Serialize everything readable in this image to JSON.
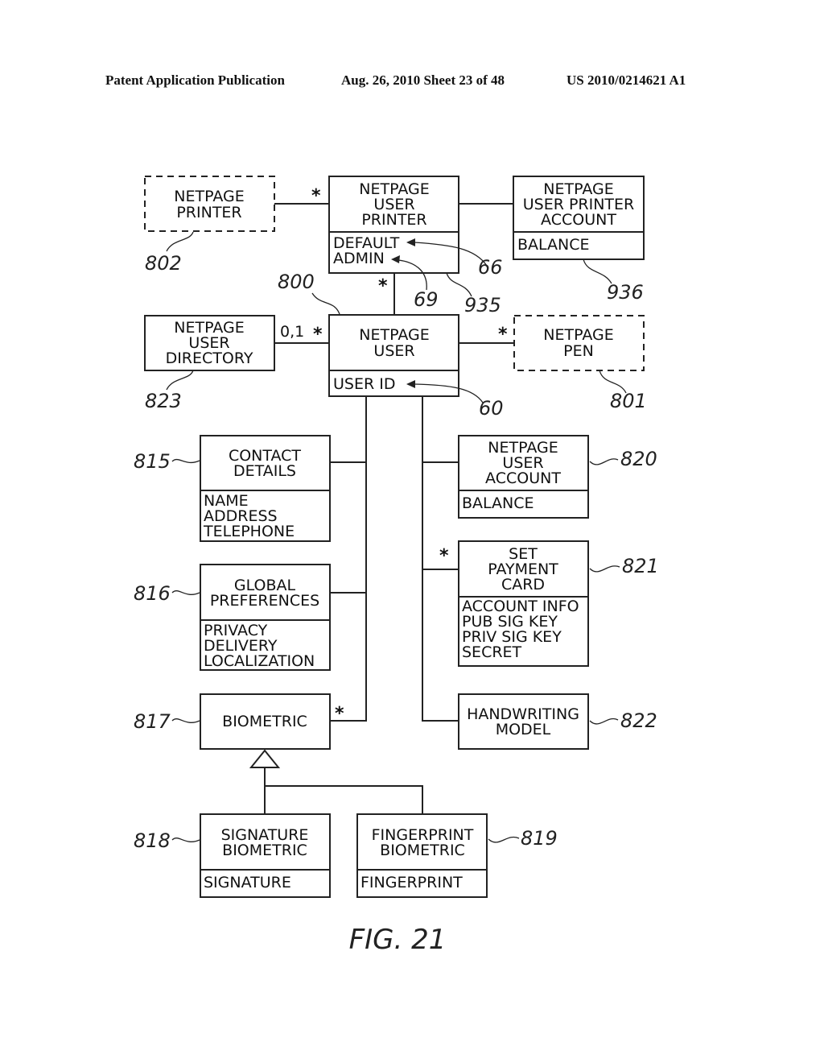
{
  "header": {
    "left": "Patent Application Publication",
    "middle": "Aug. 26, 2010  Sheet 23 of 48",
    "right": "US 2010/0214621 A1"
  },
  "figure": {
    "caption": "FIG. 21",
    "classes": {
      "netpage_printer": {
        "name": [
          "NETPAGE",
          "PRINTER"
        ],
        "ref": "802",
        "style": "dashed"
      },
      "netpage_user_printer": {
        "name": [
          "NETPAGE",
          "USER",
          "PRINTER"
        ],
        "attributes": [
          "DEFAULT",
          "ADMIN"
        ],
        "ref": "935"
      },
      "netpage_user_printer_account": {
        "name": [
          "NETPAGE",
          "USER PRINTER",
          "ACCOUNT"
        ],
        "attributes": [
          "BALANCE"
        ],
        "ref": "936"
      },
      "netpage_user_directory": {
        "name": [
          "NETPAGE",
          "USER",
          "DIRECTORY"
        ],
        "ref": "823"
      },
      "netpage_user": {
        "name": [
          "NETPAGE",
          "USER"
        ],
        "attributes": [
          "USER ID"
        ],
        "ref": "800"
      },
      "netpage_pen": {
        "name": [
          "NETPAGE",
          "PEN"
        ],
        "ref": "801",
        "style": "dashed"
      },
      "contact_details": {
        "name": [
          "CONTACT",
          "DETAILS"
        ],
        "attributes": [
          "NAME",
          "ADDRESS",
          "TELEPHONE"
        ],
        "ref": "815"
      },
      "global_preferences": {
        "name": [
          "GLOBAL",
          "PREFERENCES"
        ],
        "attributes": [
          "PRIVACY",
          "DELIVERY",
          "LOCALIZATION"
        ],
        "ref": "816"
      },
      "biometric": {
        "name": [
          "BIOMETRIC"
        ],
        "ref": "817"
      },
      "signature_biometric": {
        "name": [
          "SIGNATURE",
          "BIOMETRIC"
        ],
        "attributes": [
          "SIGNATURE"
        ],
        "ref": "818"
      },
      "fingerprint_biometric": {
        "name": [
          "FINGERPRINT",
          "BIOMETRIC"
        ],
        "attributes": [
          "FINGERPRINT"
        ],
        "ref": "819"
      },
      "netpage_user_account": {
        "name": [
          "NETPAGE",
          "USER",
          "ACCOUNT"
        ],
        "attributes": [
          "BALANCE"
        ],
        "ref": "820"
      },
      "set_payment_card": {
        "name": [
          "SET",
          "PAYMENT",
          "CARD"
        ],
        "attributes": [
          "ACCOUNT INFO",
          "PUB SIG KEY",
          "PRIV SIG KEY",
          "SECRET"
        ],
        "ref": "821"
      },
      "handwriting_model": {
        "name": [
          "HANDWRITING",
          "MODEL"
        ],
        "ref": "822"
      }
    },
    "multiplicities": {
      "printer_to_user_printer": "*",
      "user_printer_to_user": "*",
      "directory_side": "0,1",
      "user_to_directory": "*",
      "user_to_pen": "*",
      "payment_card": "*",
      "biometric": "*"
    },
    "attribute_refs": {
      "default": "66",
      "admin": "69",
      "user_id": "60"
    }
  }
}
